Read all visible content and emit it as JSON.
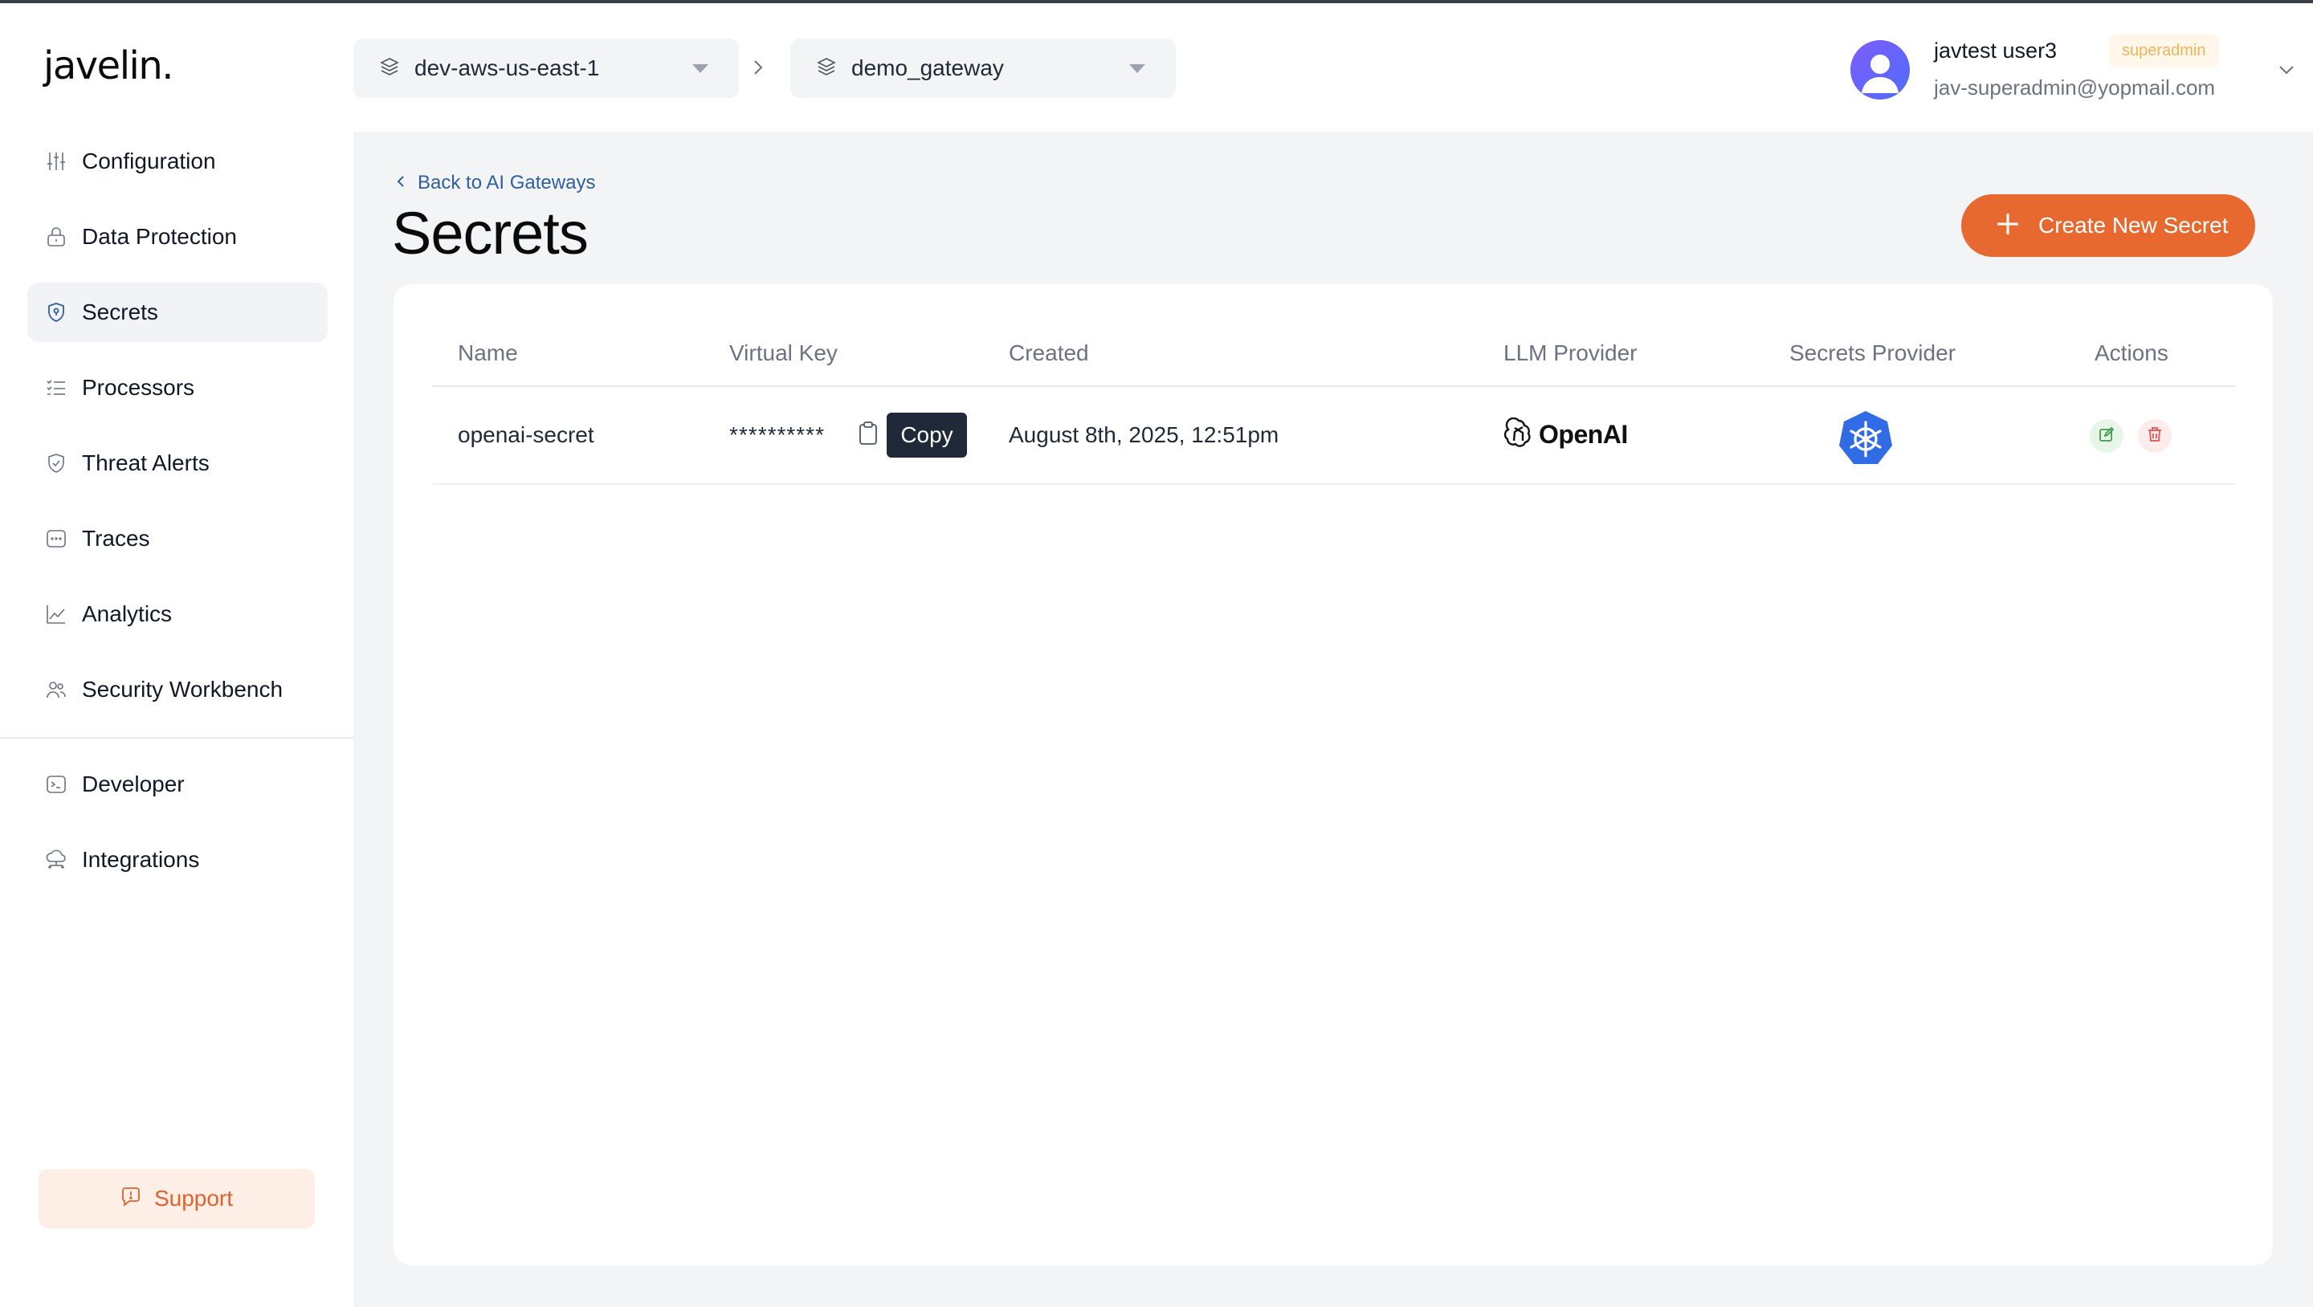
{
  "app": {
    "logo": "javelin."
  },
  "header": {
    "environment": "dev-aws-us-east-1",
    "gateway": "demo_gateway",
    "user": {
      "name": "javtest user3",
      "role": "superadmin",
      "email": "jav-superadmin@yopmail.com"
    }
  },
  "sidebar": {
    "items": [
      {
        "label": "Configuration",
        "icon": "sliders-icon"
      },
      {
        "label": "Data Protection",
        "icon": "lock-icon"
      },
      {
        "label": "Secrets",
        "icon": "shield-key-icon",
        "active": true
      },
      {
        "label": "Processors",
        "icon": "list-check-icon"
      },
      {
        "label": "Threat Alerts",
        "icon": "shield-check-icon"
      },
      {
        "label": "Traces",
        "icon": "trace-box-icon"
      },
      {
        "label": "Analytics",
        "icon": "line-chart-icon"
      },
      {
        "label": "Security Workbench",
        "icon": "users-icon"
      }
    ],
    "secondary_items": [
      {
        "label": "Developer",
        "icon": "terminal-icon"
      },
      {
        "label": "Integrations",
        "icon": "cloud-network-icon"
      }
    ],
    "support_label": "Support"
  },
  "page": {
    "back_label": "Back to AI Gateways",
    "title": "Secrets",
    "create_button": "Create New Secret"
  },
  "table": {
    "headers": [
      "Name",
      "Virtual Key",
      "Created",
      "LLM Provider",
      "Secrets Provider",
      "Actions"
    ],
    "rows": [
      {
        "name": "openai-secret",
        "virtual_key": "**********",
        "copy_tooltip": "Copy",
        "created": "August 8th, 2025, 12:51pm",
        "llm_provider": "OpenAI",
        "secrets_provider": "kubernetes-icon"
      }
    ]
  },
  "colors": {
    "accent": "#e8692f",
    "active_nav_bg": "#f1f3f6",
    "main_bg": "#f3f4f6",
    "link": "#2f5f9e",
    "kubernetes": "#326ce5"
  }
}
